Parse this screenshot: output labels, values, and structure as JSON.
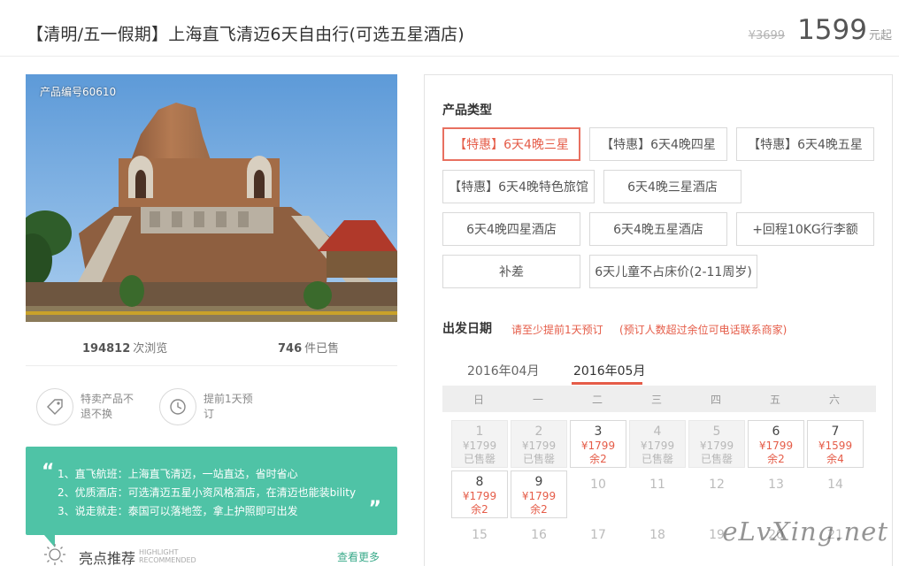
{
  "header": {
    "title": "【清明/五一假期】上海直飞清迈6天自由行(可选五星酒店)",
    "old_price": "¥3699",
    "price": "1599",
    "price_unit": "元起"
  },
  "photo": {
    "code_label": "产品编号60610"
  },
  "stats": {
    "views_num": "194812",
    "views_label": "次浏览",
    "sold_num": "746",
    "sold_label": "件已售"
  },
  "features": [
    {
      "icon": "tag-icon",
      "text": "特卖产品不退不换"
    },
    {
      "icon": "clock-history-icon",
      "text": "提前1天预订"
    }
  ],
  "highlights": [
    "1、直飞航班：上海直飞清迈，一站直达，省时省心",
    "2、优质酒店：可选清迈五星小资风格酒店，在清迈也能装bility",
    "3、说走就走：泰国可以落地签，拿上护照即可出发"
  ],
  "recommend": {
    "title": "亮点推荐",
    "sub1": "HIGHLIGHT",
    "sub2": "RECOMMENDED",
    "more": "查看更多"
  },
  "product_type": {
    "label": "产品类型",
    "options": [
      {
        "label": "【特惠】6天4晚三星",
        "selected": true
      },
      {
        "label": "【特惠】6天4晚四星",
        "selected": false
      },
      {
        "label": "【特惠】6天4晚五星",
        "selected": false
      },
      {
        "label": "【特惠】6天4晚特色旅馆",
        "selected": false
      },
      {
        "label": "6天4晚三星酒店",
        "selected": false
      },
      {
        "label": "6天4晚四星酒店",
        "selected": false
      },
      {
        "label": "6天4晚五星酒店",
        "selected": false
      },
      {
        "label": "+回程10KG行李额",
        "selected": false
      },
      {
        "label": "补差",
        "selected": false
      },
      {
        "label": "6天儿童不占床价(2-11周岁)",
        "selected": false
      }
    ]
  },
  "departure": {
    "label": "出发日期",
    "note1": "请至少提前1天预订",
    "note2": "(预订人数超过余位可电话联系商家)",
    "months": [
      {
        "label": "2016年04月",
        "active": false
      },
      {
        "label": "2016年05月",
        "active": true
      }
    ],
    "weekdays": [
      "日",
      "一",
      "二",
      "三",
      "四",
      "五",
      "六"
    ],
    "days": [
      {
        "day": "1",
        "price": "¥1799",
        "status": "已售罄",
        "state": "sold"
      },
      {
        "day": "2",
        "price": "¥1799",
        "status": "已售罄",
        "state": "sold"
      },
      {
        "day": "3",
        "price": "¥1799",
        "status": "余2",
        "state": "avail"
      },
      {
        "day": "4",
        "price": "¥1799",
        "status": "已售罄",
        "state": "sold"
      },
      {
        "day": "5",
        "price": "¥1799",
        "status": "已售罄",
        "state": "sold"
      },
      {
        "day": "6",
        "price": "¥1799",
        "status": "余2",
        "state": "avail"
      },
      {
        "day": "7",
        "price": "¥1599",
        "status": "余4",
        "state": "avail"
      },
      {
        "day": "8",
        "price": "¥1799",
        "status": "余2",
        "state": "avail"
      },
      {
        "day": "9",
        "price": "¥1799",
        "status": "余2",
        "state": "avail"
      },
      {
        "day": "10",
        "price": "",
        "status": "",
        "state": "plain"
      },
      {
        "day": "11",
        "price": "",
        "status": "",
        "state": "plain"
      },
      {
        "day": "12",
        "price": "",
        "status": "",
        "state": "plain"
      },
      {
        "day": "13",
        "price": "",
        "status": "",
        "state": "plain"
      },
      {
        "day": "14",
        "price": "",
        "status": "",
        "state": "plain"
      },
      {
        "day": "15",
        "price": "",
        "status": "",
        "state": "plain"
      },
      {
        "day": "16",
        "price": "",
        "status": "",
        "state": "plain"
      },
      {
        "day": "17",
        "price": "",
        "status": "",
        "state": "plain"
      },
      {
        "day": "18",
        "price": "",
        "status": "",
        "state": "plain"
      },
      {
        "day": "19",
        "price": "",
        "status": "",
        "state": "plain"
      },
      {
        "day": "20",
        "price": "",
        "status": "",
        "state": "plain"
      },
      {
        "day": "21",
        "price": "",
        "status": "",
        "state": "plain"
      }
    ]
  },
  "watermark": "eLvXing.net",
  "colors": {
    "accent": "#e55c48",
    "teal": "#4fc3a6"
  }
}
